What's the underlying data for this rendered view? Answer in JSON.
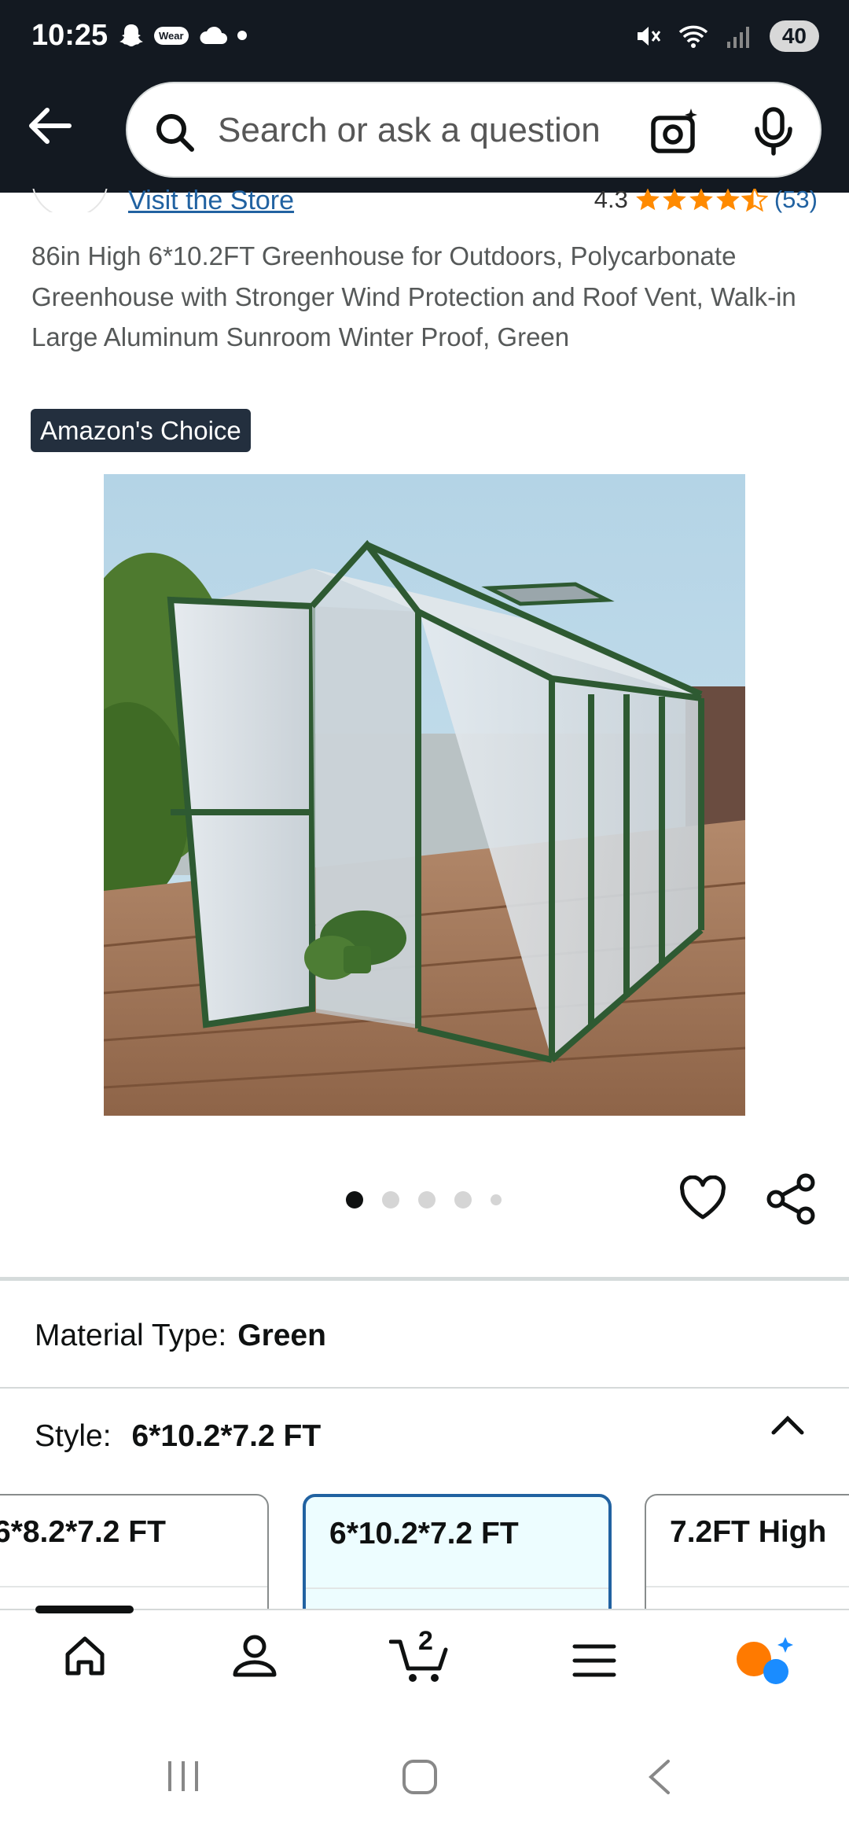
{
  "status_bar": {
    "time": "10:25",
    "wear_label": "Wear",
    "battery": "40"
  },
  "search": {
    "placeholder": "Search or ask a question"
  },
  "store": {
    "link_text": "Visit the Store"
  },
  "rating": {
    "value": "4.3",
    "stars": 4.3,
    "count": "(53)"
  },
  "product": {
    "title": "86in High 6*10.2FT Greenhouse for Outdoors, Polycarbonate Greenhouse with Stronger Wind Protection and Roof Vent, Walk-in Large Aluminum Sunroom Winter Proof, Green",
    "badge": "Amazon's Choice"
  },
  "image_carousel": {
    "count": 5,
    "active_index": 0
  },
  "material": {
    "label": "Material Type:",
    "value": "Green"
  },
  "style": {
    "label": "Style:",
    "value": "6*10.2*7.2 FT",
    "options": [
      {
        "label": "6*8.2*7.2 FT",
        "selected": false
      },
      {
        "label": "6*10.2*7.2 FT",
        "selected": true
      },
      {
        "label": "7.2FT High",
        "selected": false
      }
    ]
  },
  "bottom_nav": {
    "items": [
      "home-icon",
      "account-icon",
      "cart-icon",
      "menu-icon",
      "rufus-icon"
    ],
    "cart_count": "2"
  },
  "colors": {
    "header": "#131921",
    "link": "#2162a1",
    "star": "#ff8a00",
    "selected_border": "#2162a1"
  }
}
